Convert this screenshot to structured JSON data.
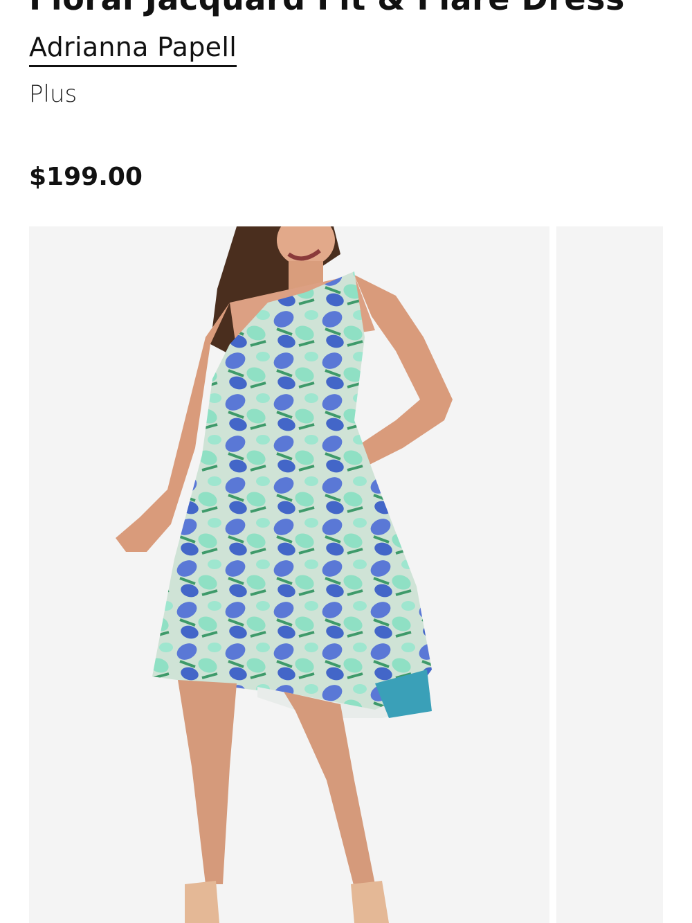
{
  "product": {
    "title": "Floral Jacquard Fit & Flare Dress",
    "brand": "Adrianna Papell",
    "size_category": "Plus",
    "price": "$199.00"
  },
  "gallery": {
    "images": [
      {
        "subject": "model wearing blue and mint floral jacquard fit and flare dress"
      },
      {
        "subject": "next product image"
      }
    ]
  },
  "colors": {
    "background": "#ffffff",
    "image_bg": "#f4f4f4",
    "text": "#111111",
    "dress_blue": "#4f6fd0",
    "dress_mint": "#8fe0c4"
  }
}
